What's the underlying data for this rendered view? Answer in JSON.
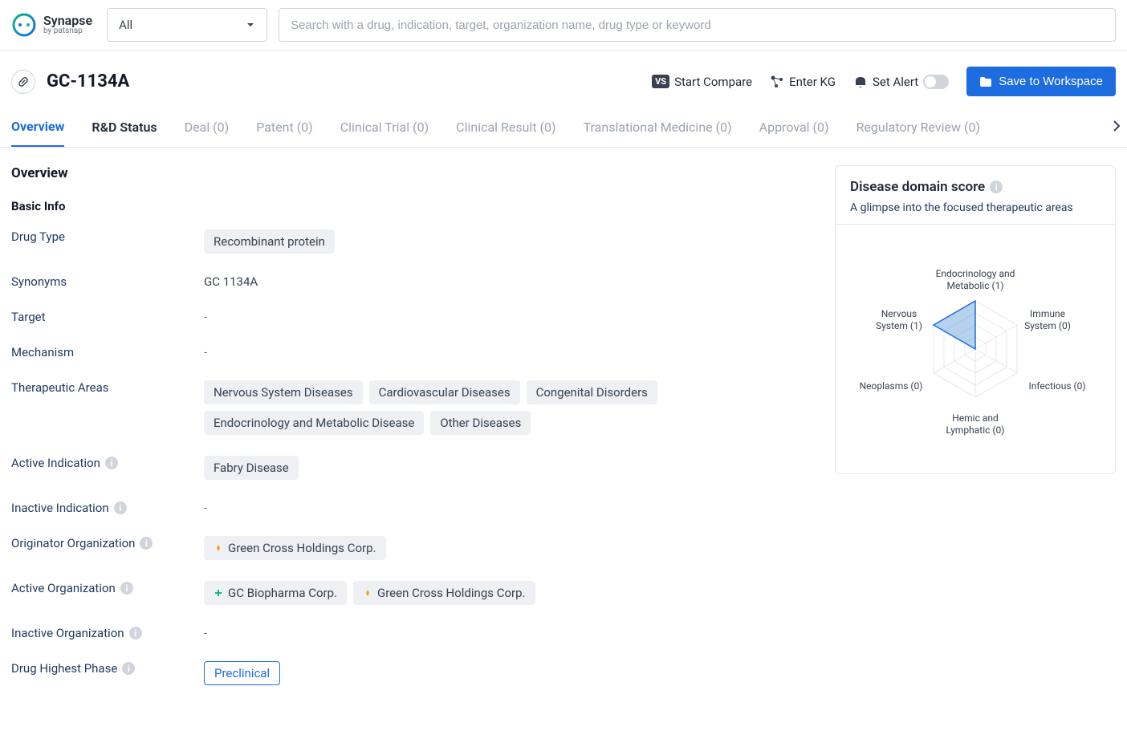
{
  "logo": {
    "name": "Synapse",
    "sub": "by patsnap"
  },
  "search": {
    "dropdown": "All",
    "placeholder": "Search with a drug, indication, target, organization name, drug type or keyword"
  },
  "page": {
    "title": "GC-1134A"
  },
  "actions": {
    "compare": "Start Compare",
    "kg": "Enter KG",
    "alert": "Set Alert",
    "save": "Save to Workspace"
  },
  "tabs": [
    "Overview",
    "R&D Status",
    "Deal (0)",
    "Patent (0)",
    "Clinical Trial (0)",
    "Clinical Result (0)",
    "Translational Medicine (0)",
    "Approval (0)",
    "Regulatory Review (0)"
  ],
  "section": {
    "overview": "Overview",
    "basic": "Basic Info"
  },
  "fields": {
    "drugType": {
      "label": "Drug Type",
      "value": "Recombinant protein"
    },
    "synonyms": {
      "label": "Synonyms",
      "value": "GC 1134A"
    },
    "target": {
      "label": "Target",
      "value": "-"
    },
    "mechanism": {
      "label": "Mechanism",
      "value": "-"
    },
    "therapeutic": {
      "label": "Therapeutic Areas",
      "values": [
        "Nervous System Diseases",
        "Cardiovascular Diseases",
        "Congenital Disorders",
        "Endocrinology and Metabolic Disease",
        "Other Diseases"
      ]
    },
    "activeInd": {
      "label": "Active Indication",
      "value": "Fabry Disease"
    },
    "inactiveInd": {
      "label": "Inactive Indication",
      "value": "-"
    },
    "origOrg": {
      "label": "Originator Organization",
      "values": [
        "Green Cross Holdings Corp."
      ]
    },
    "activeOrg": {
      "label": "Active Organization",
      "values": [
        "GC Biopharma Corp.",
        "Green Cross Holdings Corp."
      ]
    },
    "inactiveOrg": {
      "label": "Inactive Organization",
      "value": "-"
    },
    "highestPhase": {
      "label": "Drug Highest Phase",
      "value": "Preclinical"
    }
  },
  "panel": {
    "title": "Disease domain score",
    "sub": "A glimpse into the focused therapeutic areas"
  },
  "radar": {
    "labels": {
      "top": "Endocrinology and",
      "top2": "Metabolic (1)",
      "tr": "Immune",
      "tr2": "System (0)",
      "br": "Infectious (0)",
      "bot": "Hemic and",
      "bot2": "Lymphatic (0)",
      "bl": "Neoplasms (0)",
      "tl": "Nervous",
      "tl2": "System (1)"
    }
  },
  "chart_data": {
    "type": "radar",
    "title": "Disease domain score",
    "categories": [
      "Endocrinology and Metabolic",
      "Immune System",
      "Infectious",
      "Hemic and Lymphatic",
      "Neoplasms",
      "Nervous System"
    ],
    "values": [
      1,
      0,
      0,
      0,
      0,
      1
    ],
    "max": 3
  }
}
